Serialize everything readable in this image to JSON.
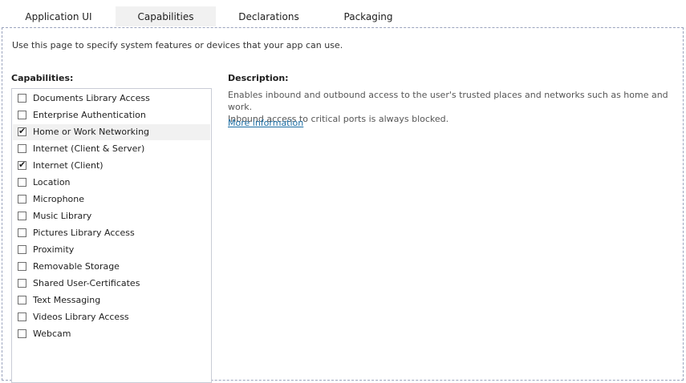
{
  "tabs": [
    {
      "label": "Application UI"
    },
    {
      "label": "Capabilities"
    },
    {
      "label": "Declarations"
    },
    {
      "label": "Packaging"
    }
  ],
  "active_tab": "Capabilities",
  "intro": "Use this page to specify system features or devices that your app can use.",
  "capabilities": {
    "header": "Capabilities:",
    "items": [
      {
        "label": "Documents Library Access",
        "checked": false
      },
      {
        "label": "Enterprise Authentication",
        "checked": false
      },
      {
        "label": "Home or Work Networking",
        "checked": true
      },
      {
        "label": "Internet (Client & Server)",
        "checked": false
      },
      {
        "label": "Internet (Client)",
        "checked": true
      },
      {
        "label": "Location",
        "checked": false
      },
      {
        "label": "Microphone",
        "checked": false
      },
      {
        "label": "Music Library",
        "checked": false
      },
      {
        "label": "Pictures Library Access",
        "checked": false
      },
      {
        "label": "Proximity",
        "checked": false
      },
      {
        "label": "Removable Storage",
        "checked": false
      },
      {
        "label": "Shared User-Certificates",
        "checked": false
      },
      {
        "label": "Text Messaging",
        "checked": false
      },
      {
        "label": "Videos Library Access",
        "checked": false
      },
      {
        "label": "Webcam",
        "checked": false
      }
    ],
    "selected_item": "Home or Work Networking"
  },
  "description": {
    "header": "Description:",
    "line1": "Enables inbound and outbound access to the user's trusted places and networks such as home and work.",
    "line2": "Inbound access to critical ports is always blocked.",
    "link": "More information"
  },
  "colors": {
    "link": "#1c6ea4",
    "selected_background": "#f1f1f1",
    "pane_border": "#9aa3bd"
  }
}
